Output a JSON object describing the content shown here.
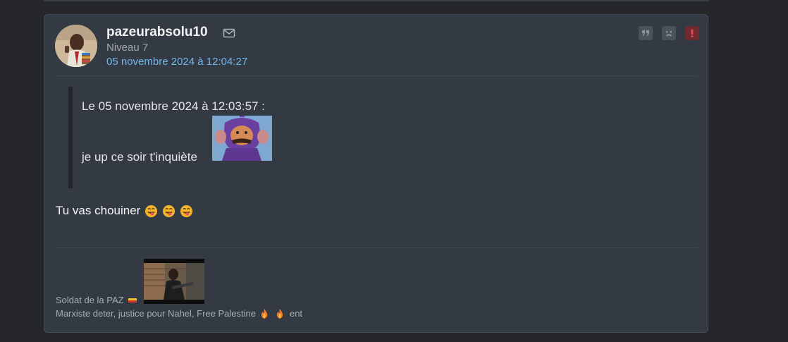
{
  "post": {
    "author": {
      "username": "pazeurabsolu10",
      "level": "Niveau 7",
      "date": "05 novembre 2024 à 12:04:27",
      "avatar_icon": "avatar-image"
    },
    "actions": [
      {
        "name": "quote",
        "icon": "quote-icon"
      },
      {
        "name": "sad",
        "icon": "sad-face-icon"
      },
      {
        "name": "report",
        "icon": "alert-icon",
        "color": "#6e2a30"
      }
    ],
    "quote": {
      "header": "Le 05 novembre 2024 à 12:03:57 :",
      "text": "je up ce soir t'inquiète",
      "sticker_icon": "teletubby-sticker"
    },
    "reply": {
      "text": "Tu vas chouiner",
      "emoji_icon": "tongue-face-emoji",
      "emoji_count": 3
    },
    "signature": {
      "line1": "Soldat de la PAZ",
      "line2": "Marxiste deter, justice pour Nahel, Free Palestine",
      "line2_tail": "ent",
      "image_icon": "signature-image"
    }
  },
  "colors": {
    "background": "#25272b",
    "card": "#343a43",
    "accent_date": "#6fb6ea",
    "report_button": "#6e2a30"
  }
}
